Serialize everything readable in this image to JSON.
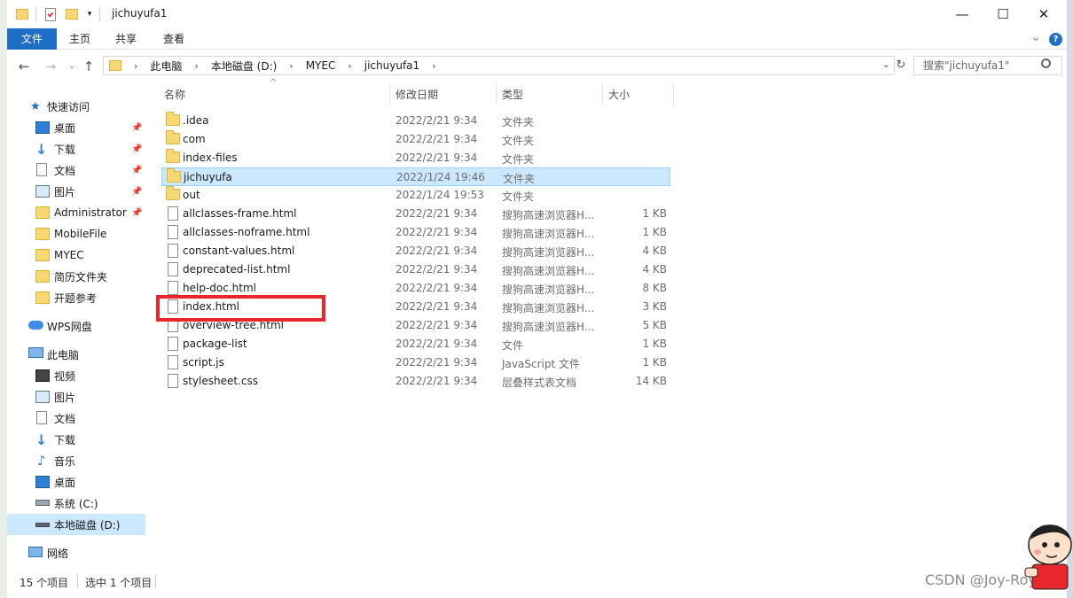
{
  "window": {
    "title": "jichuyufa1",
    "minimize": "—",
    "maximize": "☐",
    "close": "✕"
  },
  "ribbon": {
    "tabs": [
      "文件",
      "主页",
      "共享",
      "查看"
    ],
    "expand_icon": "⌄",
    "help_icon": "?"
  },
  "address": {
    "crumbs": [
      "此电脑",
      "本地磁盘 (D:)",
      "MYEC",
      "jichuyufa1"
    ],
    "search_placeholder": "搜索\"jichuyufa1\""
  },
  "sidebar": {
    "items": [
      {
        "label": "快速访问",
        "icon": "star-icon",
        "level": 0,
        "pinned": false
      },
      {
        "label": "桌面",
        "icon": "desktop-icon",
        "level": 1,
        "pinned": true
      },
      {
        "label": "下载",
        "icon": "download-icon",
        "level": 1,
        "pinned": true
      },
      {
        "label": "文档",
        "icon": "document-icon",
        "level": 1,
        "pinned": true
      },
      {
        "label": "图片",
        "icon": "pictures-icon",
        "level": 1,
        "pinned": true
      },
      {
        "label": "Administrator",
        "icon": "folder-icon",
        "level": 1,
        "pinned": true
      },
      {
        "label": "MobileFile",
        "icon": "folder-icon",
        "level": 1,
        "pinned": false
      },
      {
        "label": "MYEC",
        "icon": "folder-icon",
        "level": 1,
        "pinned": false
      },
      {
        "label": "简历文件夹",
        "icon": "folder-icon",
        "level": 1,
        "pinned": false
      },
      {
        "label": "开题参考",
        "icon": "folder-icon",
        "level": 1,
        "pinned": false
      },
      {
        "label": "WPS网盘",
        "icon": "cloud-icon",
        "level": 0,
        "pinned": false
      },
      {
        "label": "此电脑",
        "icon": "computer-icon",
        "level": 0,
        "pinned": false
      },
      {
        "label": "视频",
        "icon": "video-icon",
        "level": 1,
        "pinned": false
      },
      {
        "label": "图片",
        "icon": "pictures-icon",
        "level": 1,
        "pinned": false
      },
      {
        "label": "文档",
        "icon": "document-icon",
        "level": 1,
        "pinned": false
      },
      {
        "label": "下载",
        "icon": "download-icon",
        "level": 1,
        "pinned": false
      },
      {
        "label": "音乐",
        "icon": "music-icon",
        "level": 1,
        "pinned": false
      },
      {
        "label": "桌面",
        "icon": "desktop-icon",
        "level": 1,
        "pinned": false
      },
      {
        "label": "系统 (C:)",
        "icon": "drive-icon",
        "level": 1,
        "pinned": false
      },
      {
        "label": "本地磁盘 (D:)",
        "icon": "drive-icon",
        "level": 1,
        "pinned": false,
        "selected": true
      },
      {
        "label": "网络",
        "icon": "network-icon",
        "level": 0,
        "pinned": false
      }
    ]
  },
  "columns": {
    "name": "名称",
    "date": "修改日期",
    "type": "类型",
    "size": "大小"
  },
  "files": [
    {
      "name": ".idea",
      "date": "2022/2/21 9:34",
      "type": "文件夹",
      "size": "",
      "kind": "folder"
    },
    {
      "name": "com",
      "date": "2022/2/21 9:34",
      "type": "文件夹",
      "size": "",
      "kind": "folder"
    },
    {
      "name": "index-files",
      "date": "2022/2/21 9:34",
      "type": "文件夹",
      "size": "",
      "kind": "folder"
    },
    {
      "name": "jichuyufa",
      "date": "2022/1/24 19:46",
      "type": "文件夹",
      "size": "",
      "kind": "folder",
      "selected": true
    },
    {
      "name": "out",
      "date": "2022/1/24 19:53",
      "type": "文件夹",
      "size": "",
      "kind": "folder"
    },
    {
      "name": "allclasses-frame.html",
      "date": "2022/2/21 9:34",
      "type": "搜狗高速浏览器H...",
      "size": "1 KB",
      "kind": "file"
    },
    {
      "name": "allclasses-noframe.html",
      "date": "2022/2/21 9:34",
      "type": "搜狗高速浏览器H...",
      "size": "1 KB",
      "kind": "file"
    },
    {
      "name": "constant-values.html",
      "date": "2022/2/21 9:34",
      "type": "搜狗高速浏览器H...",
      "size": "4 KB",
      "kind": "file"
    },
    {
      "name": "deprecated-list.html",
      "date": "2022/2/21 9:34",
      "type": "搜狗高速浏览器H...",
      "size": "4 KB",
      "kind": "file"
    },
    {
      "name": "help-doc.html",
      "date": "2022/2/21 9:34",
      "type": "搜狗高速浏览器H...",
      "size": "8 KB",
      "kind": "file"
    },
    {
      "name": "index.html",
      "date": "2022/2/21 9:34",
      "type": "搜狗高速浏览器H...",
      "size": "3 KB",
      "kind": "file"
    },
    {
      "name": "overview-tree.html",
      "date": "2022/2/21 9:34",
      "type": "搜狗高速浏览器H...",
      "size": "5 KB",
      "kind": "file"
    },
    {
      "name": "package-list",
      "date": "2022/2/21 9:34",
      "type": "文件",
      "size": "1 KB",
      "kind": "file"
    },
    {
      "name": "script.js",
      "date": "2022/2/21 9:34",
      "type": "JavaScript 文件",
      "size": "1 KB",
      "kind": "file"
    },
    {
      "name": "stylesheet.css",
      "date": "2022/2/21 9:34",
      "type": "层叠样式表文档",
      "size": "14 KB",
      "kind": "file"
    }
  ],
  "status": {
    "count": "15 个项目",
    "selected": "选中 1 个项目"
  },
  "watermark": "CSDN @Joy-Roy6"
}
